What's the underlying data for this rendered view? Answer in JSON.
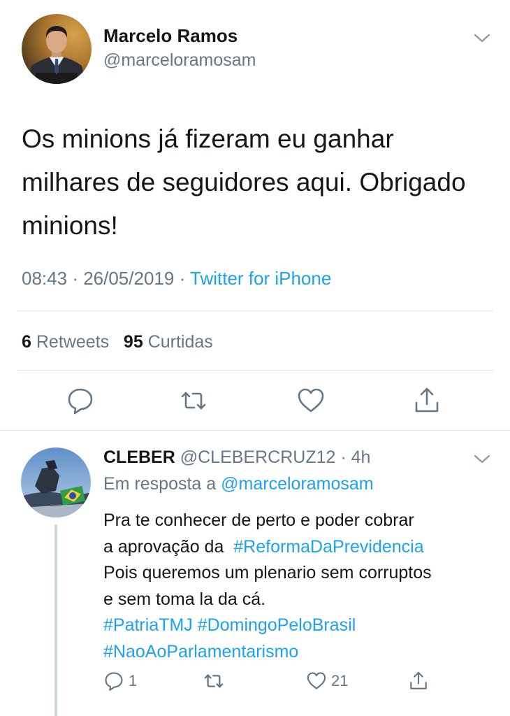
{
  "main_tweet": {
    "author_name": "Marcelo Ramos",
    "author_handle": "@marceloramosam",
    "text_lines": [
      "Os minions já fizeram eu ganhar",
      "milhares de seguidores aqui. Obrigado",
      "minions!"
    ],
    "time": "08:43",
    "date": "26/05/2019",
    "separator": "·",
    "source": "Twitter for iPhone",
    "retweets_count": "6",
    "retweets_label": "Retweets",
    "likes_count": "95",
    "likes_label": "Curtidas",
    "icons": [
      "reply-icon",
      "retweet-icon",
      "like-icon",
      "share-icon"
    ]
  },
  "reply": {
    "author_name": "CLEBER",
    "author_handle": "@CLEBERCRUZ12",
    "separator": "·",
    "time_ago": "4h",
    "replying_label": "Em resposta a",
    "replying_to": "@marceloramosam",
    "text_line1": "Pra te conhecer de perto e poder cobrar",
    "text_line2_prefix": "a aprovação da",
    "hashtag_reforma": "#ReformaDaPrevidencia",
    "text_line3": "Pois queremos um plenario sem corruptos",
    "text_line4": "e sem toma la da cá.",
    "hashtag_patria": "#PatriaTMJ",
    "hashtag_domingo": "#DomingoPeloBrasil",
    "hashtag_nao": "#NaoAoParlamentarismo",
    "reply_count": "1",
    "like_count": "21"
  },
  "colors": {
    "text": "#14171a",
    "secondary": "#657786",
    "accent": "#1da1f2",
    "divider": "#e1e8ed"
  }
}
